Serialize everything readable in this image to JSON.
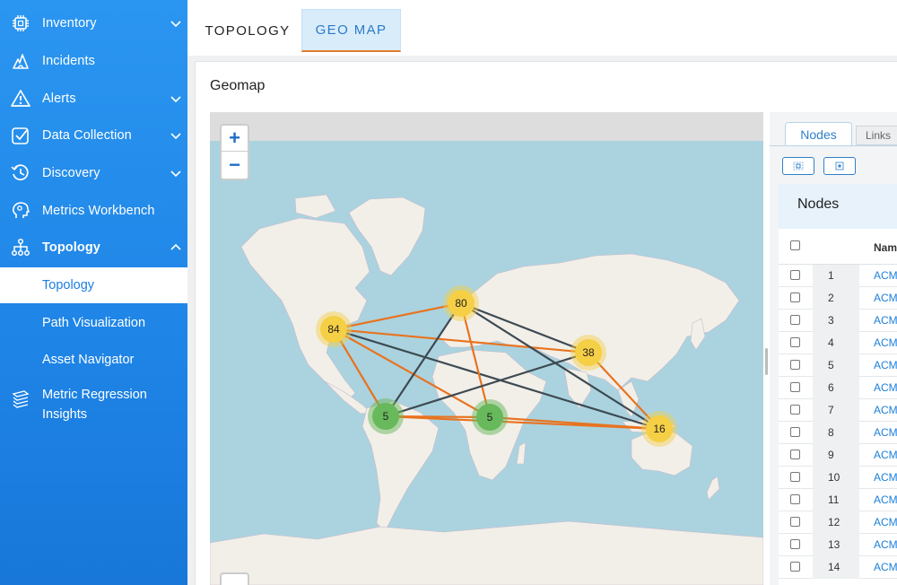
{
  "sidebar": {
    "items": [
      {
        "label": "Inventory",
        "icon": "chip-icon",
        "chevron": "down"
      },
      {
        "label": "Incidents",
        "icon": "flame-icon"
      },
      {
        "label": "Alerts",
        "icon": "warning-icon",
        "chevron": "down"
      },
      {
        "label": "Data Collection",
        "icon": "checklist-icon",
        "chevron": "down"
      },
      {
        "label": "Discovery",
        "icon": "history-icon",
        "chevron": "down"
      },
      {
        "label": "Metrics Workbench",
        "icon": "brain-icon"
      },
      {
        "label": "Topology",
        "icon": "hierarchy-icon",
        "chevron": "up"
      }
    ],
    "sub_items": [
      "Topology",
      "Path Visualization",
      "Asset Navigator"
    ],
    "active_sub": "Topology",
    "extra": {
      "label": "Metric Regression Insights",
      "icon": "stack-icon"
    }
  },
  "tabs": [
    "TOPOLOGY",
    "GEO MAP"
  ],
  "active_tab": "GEO MAP",
  "panel_title": "Geomap",
  "map": {
    "zoom_in": "+",
    "zoom_out": "−",
    "clusters": [
      {
        "label": "84",
        "status": "warning",
        "color": "#f5cf45"
      },
      {
        "label": "80",
        "status": "warning",
        "color": "#f5cf45"
      },
      {
        "label": "38",
        "status": "warning",
        "color": "#f5cf45"
      },
      {
        "label": "5",
        "status": "ok",
        "color": "#68b85c"
      },
      {
        "label": "5",
        "status": "ok",
        "color": "#68b85c"
      },
      {
        "label": "16",
        "status": "warning",
        "color": "#f5cf45"
      }
    ],
    "link_colors": {
      "orange": "#e8731f",
      "dark": "#3d4a52"
    }
  },
  "right_panel": {
    "tabs": [
      "Nodes",
      "Links"
    ],
    "header": "Nodes",
    "column": "Nam",
    "rows": [
      {
        "num": "1",
        "name": "ACM"
      },
      {
        "num": "2",
        "name": "ACM"
      },
      {
        "num": "3",
        "name": "ACM"
      },
      {
        "num": "4",
        "name": "ACM"
      },
      {
        "num": "5",
        "name": "ACM"
      },
      {
        "num": "6",
        "name": "ACM"
      },
      {
        "num": "7",
        "name": "ACM"
      },
      {
        "num": "8",
        "name": "ACM"
      },
      {
        "num": "9",
        "name": "ACM"
      },
      {
        "num": "10",
        "name": "ACM"
      },
      {
        "num": "11",
        "name": "ACM"
      },
      {
        "num": "12",
        "name": "ACM"
      },
      {
        "num": "13",
        "name": "ACM"
      },
      {
        "num": "14",
        "name": "ACM"
      }
    ]
  }
}
